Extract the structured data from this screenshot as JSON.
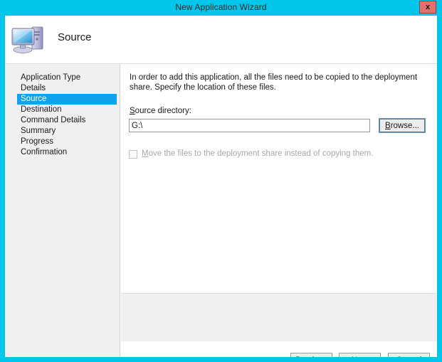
{
  "window": {
    "title": "New Application Wizard",
    "close_label": "x",
    "frame_color": "#00c6e9",
    "close_button_color": "#e2716b"
  },
  "header": {
    "title": "Source",
    "icon": "computer-monitor-icon"
  },
  "sidebar": {
    "items": [
      {
        "label": "Application Type",
        "selected": false
      },
      {
        "label": "Details",
        "selected": false
      },
      {
        "label": "Source",
        "selected": true
      },
      {
        "label": "Destination",
        "selected": false
      },
      {
        "label": "Command Details",
        "selected": false
      },
      {
        "label": "Summary",
        "selected": false
      },
      {
        "label": "Progress",
        "selected": false
      },
      {
        "label": "Confirmation",
        "selected": false
      }
    ],
    "selected_color": "#0fa3ed"
  },
  "content": {
    "intro_text": "In order to add this application, all the files need to be copied to the deployment share.  Specify the location of these files.",
    "source_label_pre": "S",
    "source_label_post": "ource directory:",
    "source_value": "G:\\",
    "source_placeholder": "",
    "browse_label_pre": "B",
    "browse_label_post": "rowse...",
    "move_checkbox_checked": false,
    "move_checkbox_enabled": false,
    "move_label_pre": "M",
    "move_label_post": "ove the files to the deployment share instead of copying them."
  },
  "footer": {
    "previous_pre": "P",
    "previous_post": "revious",
    "next_pre": "N",
    "next_mid": "e",
    "next_post": "xt",
    "cancel_pre": "C",
    "cancel_post": "ancel"
  }
}
